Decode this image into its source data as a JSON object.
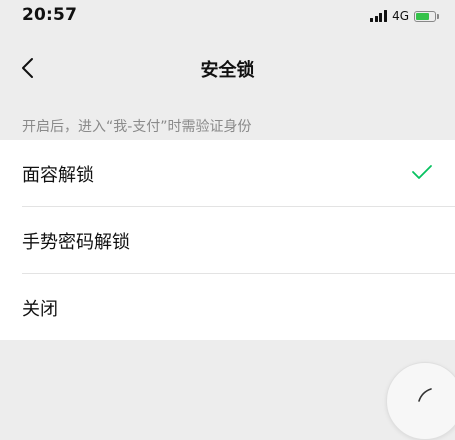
{
  "status_bar": {
    "time": "20:57",
    "network": "4G",
    "battery_color": "#35c24a"
  },
  "nav": {
    "back_icon": "chevron-left-icon",
    "title": "安全锁"
  },
  "hint": "开启后，进入“我-支付”时需验证身份",
  "options": [
    {
      "label": "面容解锁",
      "selected": true
    },
    {
      "label": "手势密码解锁",
      "selected": false
    },
    {
      "label": "关闭",
      "selected": false
    }
  ],
  "accent_color": "#07c160",
  "float_button_icon": "floating-window-icon"
}
